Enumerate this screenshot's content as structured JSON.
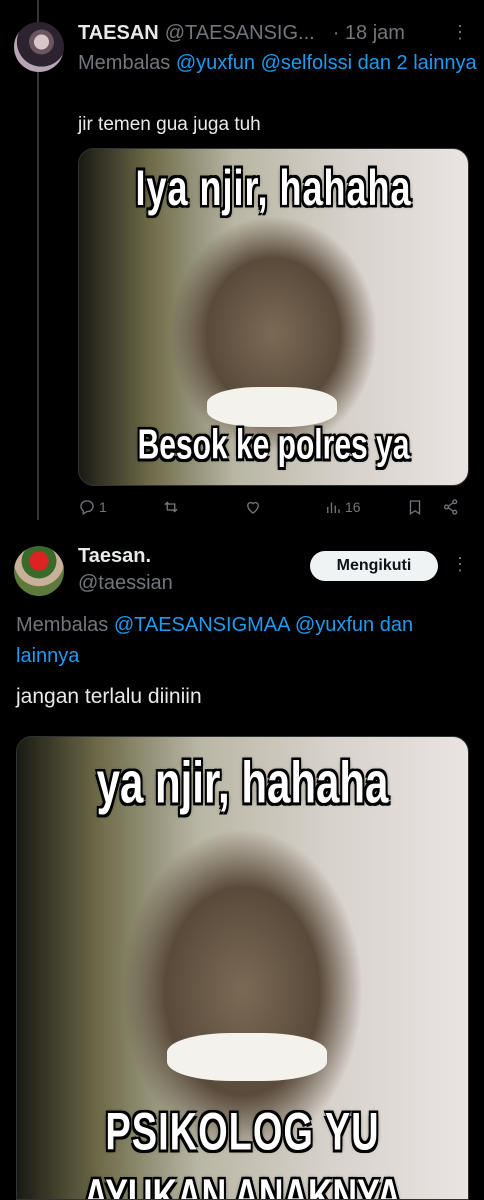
{
  "tweet1": {
    "name": "TAESAN",
    "handle": "@TAESANSIG...",
    "time": "· 18 jam",
    "more": "⋮",
    "reply_prefix": "Membalas",
    "mention1": "@yuxfun",
    "mention2": "@selfolssi",
    "reply_suffix": "dan 2 lainnya",
    "text": "jir temen gua juga tuh",
    "meme_top": "Iya njir, hahaha",
    "meme_bottom": "Besok ke polres ya",
    "replies": "1",
    "views": "16"
  },
  "tweet2": {
    "name": "Taesan.",
    "handle": "@taessian",
    "follow_label": "Mengikuti",
    "more": "⋮",
    "reply_prefix": "Membalas",
    "mention1": "@TAESANSIGMAA",
    "mention2": "@yuxfun",
    "reply_suffix_1": "dan",
    "reply_suffix_2": "lainnya",
    "text": "jangan terlalu diiniin",
    "meme_top": "ya njir, hahaha",
    "meme_bottom": "PSIKOLOG YU",
    "meme_bottom2": "AYUKAN ANAKNYA"
  },
  "colors": {
    "background": "#000000",
    "text": "#e7e9ea",
    "muted": "#71767b",
    "link": "#1d9bf0",
    "button_bg": "#eff3f4"
  },
  "icons": [
    "reply-icon",
    "retweet-icon",
    "like-icon",
    "views-icon",
    "bookmark-icon",
    "share-icon"
  ]
}
